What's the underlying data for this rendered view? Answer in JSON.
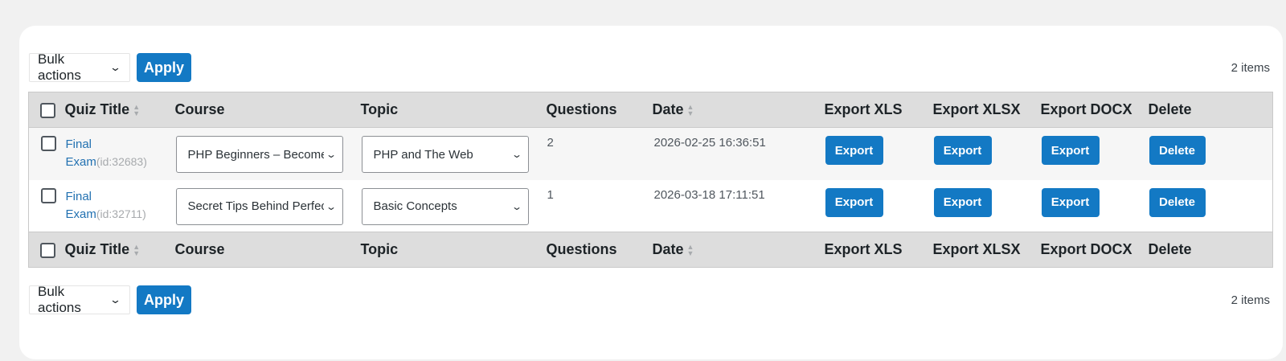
{
  "tablenav": {
    "bulk_label": "Bulk actions",
    "apply_label": "Apply",
    "items_count": "2 items"
  },
  "columns": {
    "quiz_title": "Quiz Title",
    "course": "Course",
    "topic": "Topic",
    "questions": "Questions",
    "date": "Date",
    "export_xls": "Export XLS",
    "export_xlsx": "Export XLSX",
    "export_docx": "Export DOCX",
    "delete": "Delete"
  },
  "rows": [
    {
      "title": "Final Exam",
      "id": "(id:32683)",
      "course": "PHP Beginners – Become a PHP Master",
      "topic": "PHP and The Web",
      "questions": "2",
      "date": "2026-02-25 16:36:51"
    },
    {
      "title": "Final Exam",
      "id": "(id:32711)",
      "course": "Secret Tips Behind Perfect Photos",
      "topic": "Basic Concepts",
      "questions": "1",
      "date": "2026-03-18 17:11:51"
    }
  ],
  "buttons": {
    "export_label": "Export",
    "delete_label": "Delete"
  },
  "icons": {
    "sort": "sort-arrows-icon",
    "dropdown": "chevron-down-icon"
  },
  "colors": {
    "primary": "#1379c4",
    "header_bg": "#dddddd",
    "link": "#2271b1"
  }
}
